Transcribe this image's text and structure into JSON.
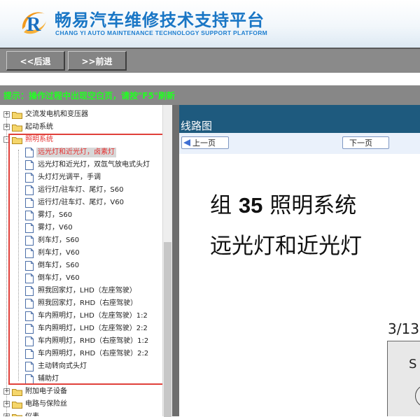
{
  "header": {
    "title_cn": "畅易汽车维修技术支持平台",
    "title_en": "CHANG YI AUTO MAINTENANCE TECHNOLOGY SUPPORT PLATFORM",
    "brand_color": "#1976c5"
  },
  "nav": {
    "back_label": "<<后退",
    "forward_label": ">>前进"
  },
  "tip": "提示：操作过程中出现空白页，请按\"F5\"刷新",
  "tree": {
    "top_items": [
      {
        "label": "交流发电机和变压器",
        "expander": "+"
      },
      {
        "label": "起动系统",
        "expander": "+"
      }
    ],
    "open_item": {
      "label": "照明系统",
      "expander": "-"
    },
    "children": [
      "远光灯和近光灯，卤素灯",
      "远光灯和近光灯，双氙气放电式头灯",
      "头灯灯光调平，手调",
      "运行灯/驻车灯、尾灯，S60",
      "运行灯/驻车灯、尾灯，V60",
      "雾灯，S60",
      "雾灯，V60",
      "刹车灯，S60",
      "刹车灯，V60",
      "倒车灯，S60",
      "倒车灯，V60",
      "照我回家灯，LHD（左座驾驶）",
      "照我回家灯，RHD（右座驾驶）",
      "车内照明灯，LHD（左座驾驶）1:2",
      "车内照明灯，LHD（左座驾驶）2:2",
      "车内照明灯，RHD（右座驾驶）1:2",
      "车内照明灯，RHD（右座驾驶）2:2",
      "主动转向式头灯",
      "辅助灯"
    ],
    "selected_child": "远光灯和近光灯，卤素灯",
    "bottom_items": [
      {
        "label": "附加电子设备",
        "expander": "+"
      },
      {
        "label": "电路与保险丝",
        "expander": "+"
      },
      {
        "label": "仪表",
        "expander": "+"
      }
    ]
  },
  "viewer": {
    "header_title": "线路图",
    "prev_label": "上一页",
    "next_label": "下一页",
    "doc_group": "组",
    "doc_group_num": "35",
    "doc_title": "照明系统",
    "doc_subtitle": "远光灯和近光灯",
    "page_number": "3/13",
    "diagram_letter": "S"
  },
  "colors": {
    "highlight_box": "#e0403a",
    "tip_text": "#22ff22",
    "viewer_header": "#1e5a7e",
    "nav_bar": "#8a8a8a"
  }
}
